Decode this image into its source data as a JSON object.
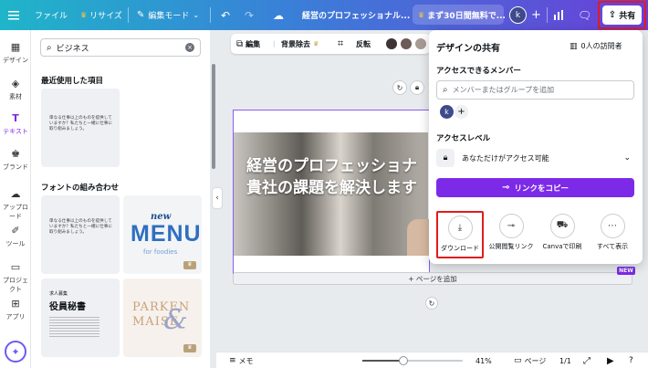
{
  "topbar": {
    "file": "ファイル",
    "resize": "リサイズ",
    "edit_mode": "編集モード",
    "doc_title": "経営のプロフェッショナル...",
    "trial": "まず30日間無料で...",
    "avatar_letter": "k",
    "share": "共有"
  },
  "rail": {
    "items": [
      "デザイン",
      "素材",
      "テキスト",
      "ブランド",
      "アップロード",
      "ツール",
      "プロジェクト",
      "アプリ"
    ]
  },
  "panel": {
    "search_value": "ビジネス",
    "recent_title": "最近使用した項目",
    "font_combo_title": "フォントの組み合わせ",
    "recent_card_text": "単なる仕事以上のものを提供していますか？私たちと一緒に仕事に取り組みましょう。",
    "card1_text": "単なる仕事以上のものを提供していますか？私たちと一緒に仕事に取り組みましょう。",
    "menu_new": "new",
    "menu_big": "MENU",
    "menu_sub": "for foodies",
    "card3_small": "求人募集",
    "card3_title": "役員秘書",
    "card4_text1": "PARKEN",
    "card4_text2": "MAISE"
  },
  "toolbar": {
    "edit": "編集",
    "bg_remove": "背景除去",
    "flip": "反転",
    "swatches": [
      "#3d3535",
      "#6b5a55",
      "#a89a94",
      "#ddd6d1"
    ]
  },
  "design": {
    "line1": "経営のプロフェッショナ",
    "line2": "貴社の課題を解決します"
  },
  "canvas": {
    "add_page": "+ ページを追加",
    "new_badge": "NEW"
  },
  "bottombar": {
    "memo": "メモ",
    "zoom": "41%",
    "zoom_fraction": 0.41,
    "pages_label": "ページ",
    "page_count": "1/1"
  },
  "share_popup": {
    "title": "デザインの共有",
    "visitors": "0人の訪問者",
    "members_label": "アクセスできるメンバー",
    "members_placeholder": "メンバーまたはグループを追加",
    "member_avatar": "k",
    "access_level_label": "アクセスレベル",
    "access_value": "あなただけがアクセス可能",
    "copy_link": "リンクをコピー",
    "options": [
      "ダウンロード",
      "公開閲覧リンク",
      "Canvaで印刷",
      "すべて表示"
    ],
    "accent": "#7d2ae8",
    "highlight": "#e21b1b"
  }
}
